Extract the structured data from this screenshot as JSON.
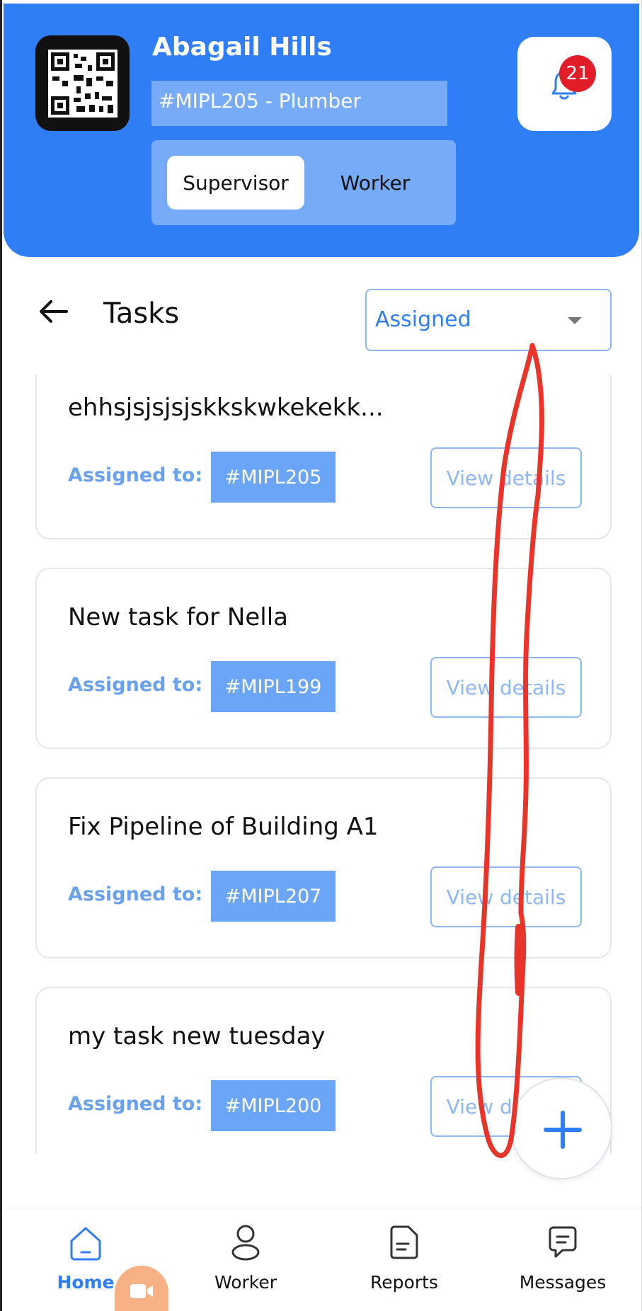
{
  "header": {
    "name": "Abagail Hills",
    "id_role": "#MIPL205 - Plumber",
    "role_toggle": {
      "options": [
        "Supervisor",
        "Worker"
      ],
      "selected": "Supervisor"
    },
    "notification_count": "21"
  },
  "tasks": {
    "title": "Tasks",
    "filter": {
      "selected": "Assigned"
    },
    "items": [
      {
        "title": "ehhsjsjsjsjskkskwkekekk...",
        "assigned_label": "Assigned to:",
        "assignee": "#MIPL205",
        "action": "View details"
      },
      {
        "title": "New task for Nella",
        "assigned_label": "Assigned to:",
        "assignee": "#MIPL199",
        "action": "View details"
      },
      {
        "title": "Fix Pipeline of Building A1",
        "assigned_label": "Assigned to:",
        "assignee": "#MIPL207",
        "action": "View details"
      },
      {
        "title": "my task new tuesday",
        "assigned_label": "Assigned to:",
        "assignee": "#MIPL200",
        "action": "View details"
      }
    ]
  },
  "fab": {
    "icon": "plus-icon"
  },
  "bottom_nav": {
    "items": [
      {
        "label": "Home",
        "icon": "home-icon",
        "active": true
      },
      {
        "label": "Worker",
        "icon": "person-icon",
        "active": false
      },
      {
        "label": "Reports",
        "icon": "document-icon",
        "active": false
      },
      {
        "label": "Messages",
        "icon": "message-icon",
        "active": false
      }
    ]
  },
  "colors": {
    "brand_blue": "#2f7ef5",
    "chip_blue": "#6aa5f7",
    "badge_red": "#e11d2a",
    "annotation_red": "#e8352b"
  }
}
